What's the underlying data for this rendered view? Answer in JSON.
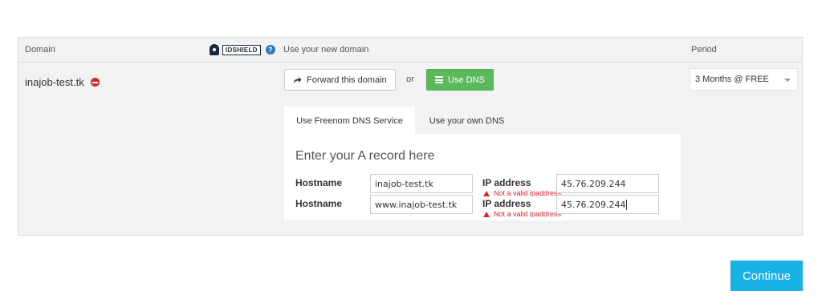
{
  "header": {
    "domain_label": "Domain",
    "use_domain_label": "Use your new domain",
    "period_label": "Period",
    "idshield_badge": "IDSHIELD",
    "help_glyph": "?"
  },
  "domain": {
    "name": "inajob-test.tk",
    "remove_icon": "remove-circle-icon"
  },
  "actions": {
    "forward_label": "Forward this domain",
    "or_label": "or",
    "use_dns_label": "Use DNS",
    "forward_icon": "share-arrow-icon",
    "dns_icon": "list-icon"
  },
  "period": {
    "selected": "3 Months @ FREE"
  },
  "dns": {
    "tabs": [
      {
        "label": "Use Freenom DNS Service",
        "active": true
      },
      {
        "label": "Use your own DNS",
        "active": false
      }
    ],
    "form_title": "Enter your A record here",
    "rows": [
      {
        "hostname_label": "Hostname",
        "hostname_value": "inajob-test.tk",
        "ip_label": "IP address",
        "ip_value": "45.76.209.244",
        "error": "Not a valid ipaddress"
      },
      {
        "hostname_label": "Hostname",
        "hostname_value": "www.inajob-test.tk",
        "ip_label": "IP address",
        "ip_value": "45.76.209.244",
        "error": "Not a valid ipaddress"
      }
    ]
  },
  "footer": {
    "continue_label": "Continue"
  },
  "colors": {
    "green": "#5cb85c",
    "blue": "#1ab0e8",
    "error_red": "#d9252a"
  }
}
